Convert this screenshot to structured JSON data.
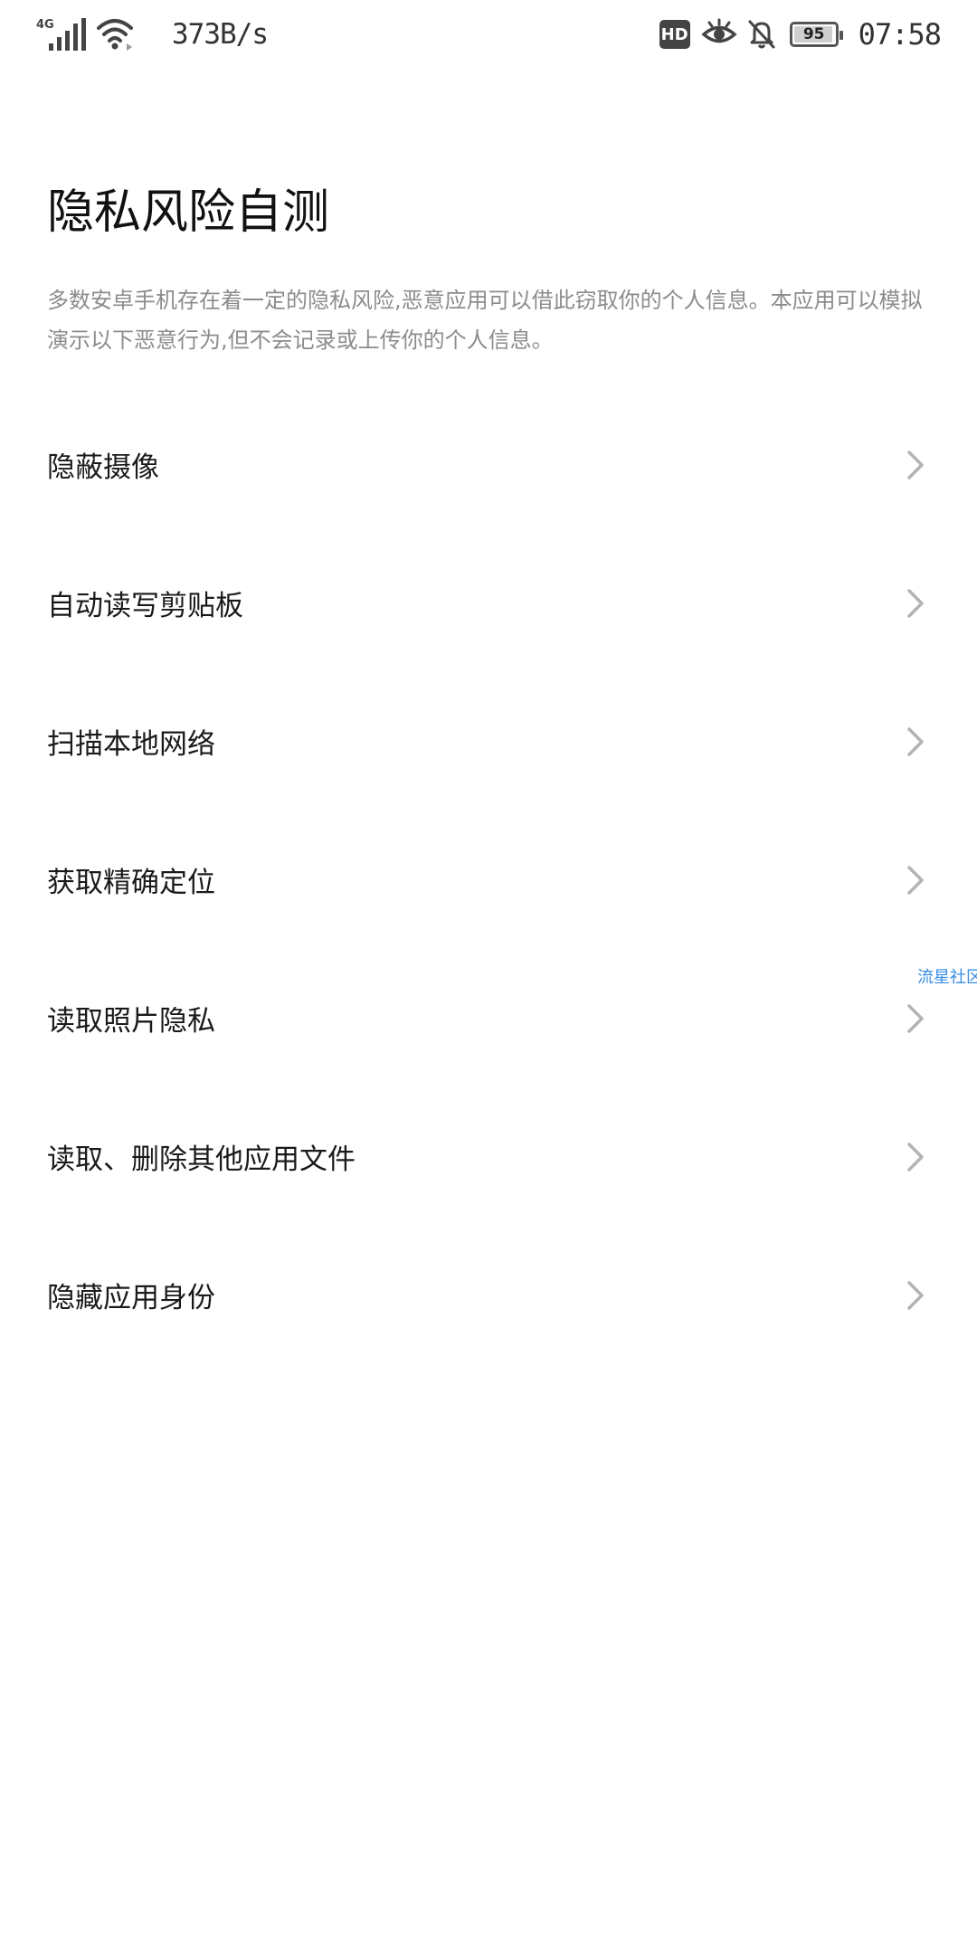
{
  "status_bar": {
    "network_type": "4G",
    "net_speed": "373B/s",
    "hd_label": "HD",
    "battery_level": "95",
    "time": "07:58",
    "icons": [
      "signal-icon",
      "wifi-icon",
      "hd-icon",
      "eye-comfort-icon",
      "bell-muted-icon",
      "battery-icon"
    ]
  },
  "page": {
    "title": "隐私风险自测",
    "description": "多数安卓手机存在着一定的隐私风险,恶意应用可以借此窃取你的个人信息。本应用可以模拟演示以下恶意行为,但不会记录或上传你的个人信息。"
  },
  "menu": {
    "items": [
      {
        "label": "隐蔽摄像"
      },
      {
        "label": "自动读写剪贴板"
      },
      {
        "label": "扫描本地网络"
      },
      {
        "label": "获取精确定位"
      },
      {
        "label": "读取照片隐私"
      },
      {
        "label": "读取、删除其他应用文件"
      },
      {
        "label": "隐藏应用身份"
      }
    ]
  },
  "floating_tag": "流星社区",
  "colors": {
    "background": "#ffffff",
    "text_primary": "#1a1a1a",
    "text_secondary": "#8c8c8c",
    "chevron": "#b3b3b3",
    "floating_tag": "#3a8ee6"
  }
}
